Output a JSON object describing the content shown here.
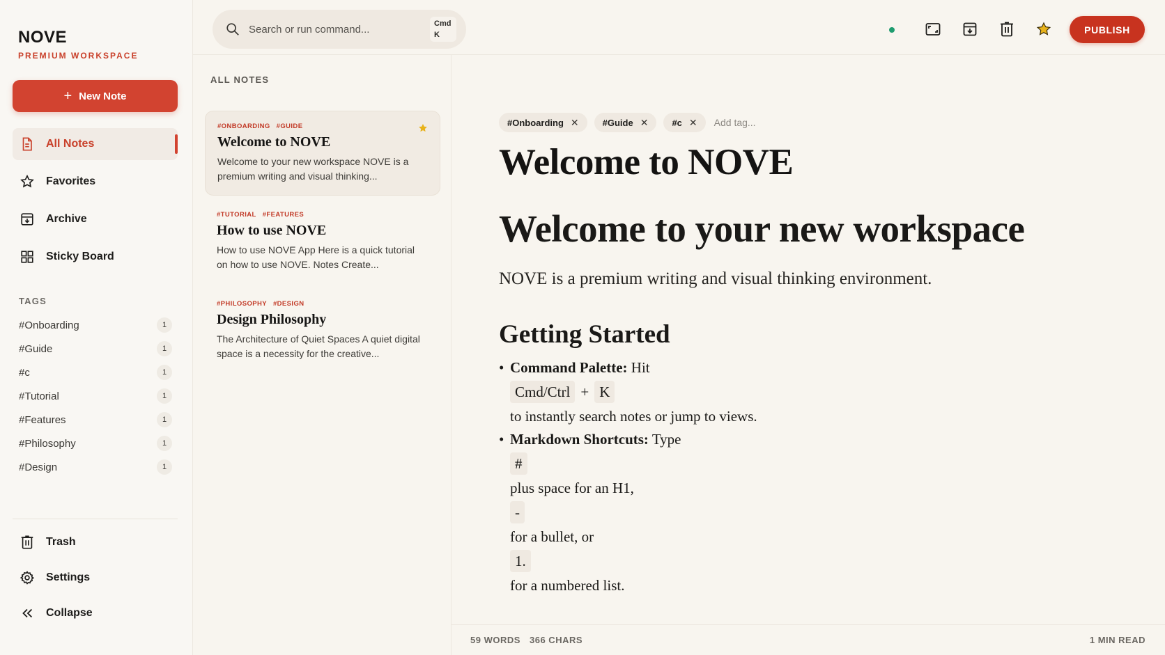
{
  "brand": {
    "name": "NOVE",
    "subtitle": "PREMIUM WORKSPACE"
  },
  "new_note_label": "New Note",
  "nav": [
    {
      "label": "All Notes",
      "icon": "document-icon"
    },
    {
      "label": "Favorites",
      "icon": "star-outline-icon"
    },
    {
      "label": "Archive",
      "icon": "archive-icon"
    },
    {
      "label": "Sticky Board",
      "icon": "grid-icon"
    }
  ],
  "tags_title": "TAGS",
  "tags": [
    {
      "name": "#Onboarding",
      "count": "1"
    },
    {
      "name": "#Guide",
      "count": "1"
    },
    {
      "name": "#c",
      "count": "1"
    },
    {
      "name": "#Tutorial",
      "count": "1"
    },
    {
      "name": "#Features",
      "count": "1"
    },
    {
      "name": "#Philosophy",
      "count": "1"
    },
    {
      "name": "#Design",
      "count": "1"
    }
  ],
  "bottom_nav": [
    {
      "label": "Trash",
      "icon": "trash-icon"
    },
    {
      "label": "Settings",
      "icon": "gear-icon"
    },
    {
      "label": "Collapse",
      "icon": "double-chevron-left-icon"
    }
  ],
  "search": {
    "placeholder": "Search or run command...",
    "kbd_line1": "Cmd",
    "kbd_line2": "K"
  },
  "publish_label": "PUBLISH",
  "colors": {
    "accent": "#d24330",
    "status": "#1e9c6f",
    "star": "#e8b21a"
  },
  "list": {
    "title": "ALL NOTES",
    "notes": [
      {
        "tags": [
          "#ONBOARDING",
          "#GUIDE"
        ],
        "title": "Welcome to NOVE",
        "snippet": "Welcome to your new workspace NOVE is a premium writing and visual thinking...",
        "favorite": true
      },
      {
        "tags": [
          "#TUTORIAL",
          "#FEATURES"
        ],
        "title": "How to use NOVE",
        "snippet": "How to use NOVE App Here is a quick tutorial on how to use NOVE. Notes Create..."
      },
      {
        "tags": [
          "#PHILOSOPHY",
          "#DESIGN"
        ],
        "title": "Design Philosophy",
        "snippet": "The Architecture of Quiet Spaces A quiet digital space is a necessity for the creative..."
      }
    ]
  },
  "editor": {
    "tags": [
      "#Onboarding",
      "#Guide",
      "#c"
    ],
    "add_tag_placeholder": "Add tag...",
    "title": "Welcome to NOVE",
    "h1": "Welcome to your new workspace",
    "lede": "NOVE is a premium writing and visual thinking environment.",
    "h2": "Getting Started",
    "bullet1": {
      "bold": "Command Palette:",
      "text": "Hit",
      "key1": "Cmd/Ctrl",
      "plus": "+",
      "key2": "K",
      "tail": "to instantly search notes or jump to views."
    },
    "bullet2": {
      "bold": "Markdown Shortcuts:",
      "text": "Type",
      "code1": "#",
      "text2": "plus space for an H1,",
      "code2": "-",
      "text3": "for a bullet, or",
      "code3": "1.",
      "text4": "for a numbered list."
    }
  },
  "footer": {
    "words": "59 WORDS",
    "chars": "366 CHARS",
    "read": "1 MIN READ"
  }
}
